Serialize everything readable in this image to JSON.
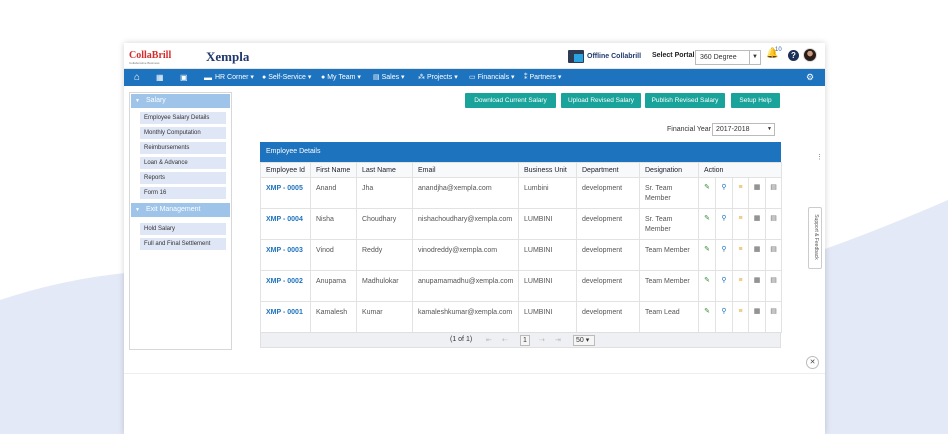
{
  "brand": {
    "collabrill": "CollaBrill",
    "collabrill_sub": "Collaborative Business",
    "xempla": "Xempla"
  },
  "topbar": {
    "offline_label": "Offline Collabrill",
    "portal_label": "Select Portal:",
    "portal_value": "360 Degree",
    "notification_count": "10",
    "help_label": "?"
  },
  "nav": {
    "items": [
      "HR Corner",
      "Self-Service",
      "My Team",
      "Sales",
      "Projects",
      "Financials",
      "Partners"
    ],
    "icons": [
      "home-icon",
      "calendar-icon",
      "bus-icon",
      "briefcase-icon",
      "user-icon",
      "users-icon",
      "chart-icon",
      "sitemap-icon",
      "money-icon",
      "handshake-icon",
      "gear-icon"
    ]
  },
  "sidebar": {
    "section1": "Salary",
    "section1_items": [
      "Employee Salary Details",
      "Monthly Computation",
      "Reimbursements",
      "Loan & Advance",
      "Reports",
      "Form 16"
    ],
    "section2": "Exit Management",
    "section2_items": [
      "Hold Salary",
      "Full and Final Settlement"
    ]
  },
  "actions": {
    "download": "Download Current Salary",
    "upload": "Upload Revised Salary",
    "publish": "Publish Revised Salary",
    "setup": "Setup Help"
  },
  "financial_year": {
    "label": "Financial Year",
    "value": "2017-2018"
  },
  "table": {
    "title": "Employee Details",
    "headers": [
      "Employee Id",
      "First Name",
      "Last Name",
      "Email",
      "Business Unit",
      "Department",
      "Designation",
      "Action"
    ],
    "rows": [
      {
        "id": "XMP - 0005",
        "first": "Anand",
        "last": "Jha",
        "email": "anandjha@xempla.com",
        "unit": "Lumbini",
        "dept": "development",
        "designation": "Sr. Team Member"
      },
      {
        "id": "XMP - 0004",
        "first": "Nisha",
        "last": "Choudhary",
        "email": "nishachoudhary@xempla.com",
        "unit": "LUMBINI",
        "dept": "development",
        "designation": "Sr. Team Member"
      },
      {
        "id": "XMP - 0003",
        "first": "Vinod",
        "last": "Reddy",
        "email": "vinodreddy@xempla.com",
        "unit": "LUMBINI",
        "dept": "development",
        "designation": "Team Member"
      },
      {
        "id": "XMP - 0002",
        "first": "Anupama",
        "last": "Madhulokar",
        "email": "anupamamadhu@xempla.com",
        "unit": "LUMBINI",
        "dept": "development",
        "designation": "Team Member"
      },
      {
        "id": "XMP - 0001",
        "first": "Kamalesh",
        "last": "Kumar",
        "email": "kamaleshkumar@xempla.com",
        "unit": "LUMBINI",
        "dept": "development",
        "designation": "Team Lead"
      }
    ]
  },
  "pager": {
    "info": "(1 of 1)",
    "page": "1",
    "per_page": "50"
  },
  "feedback": "Support & Feedback",
  "colors": {
    "nav": "#1e73be",
    "button": "#1aa39a",
    "sidebar_head": "#9ec4ea"
  }
}
